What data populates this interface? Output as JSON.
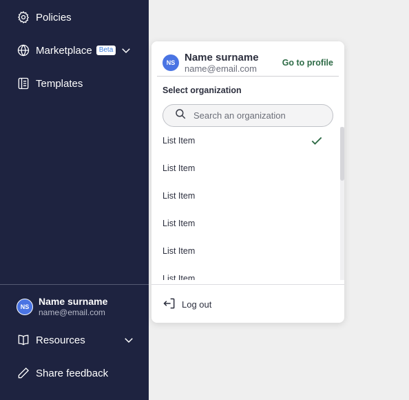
{
  "sidebar": {
    "nav": [
      {
        "label": "Policies",
        "icon": "gear-icon"
      },
      {
        "label": "Marketplace",
        "icon": "globe-icon",
        "badge": "Beta"
      },
      {
        "label": "Templates",
        "icon": "template-icon"
      }
    ],
    "user": {
      "initials": "NS",
      "name": "Name surname",
      "email": "name@email.com"
    },
    "resources_label": "Resources",
    "feedback_label": "Share feedback"
  },
  "popup": {
    "user": {
      "initials": "NS",
      "name": "Name surname",
      "email": "name@email.com"
    },
    "go_to_profile": "Go to profile",
    "select_label": "Select organization",
    "search_placeholder": "Search an organization",
    "items": [
      {
        "label": "List Item",
        "selected": true
      },
      {
        "label": "List Item",
        "selected": false
      },
      {
        "label": "List Item",
        "selected": false
      },
      {
        "label": "List Item",
        "selected": false
      },
      {
        "label": "List Item",
        "selected": false
      },
      {
        "label": "List Item",
        "selected": false
      }
    ],
    "logout_label": "Log out"
  },
  "colors": {
    "sidebar_bg": "#1e2340",
    "avatar": "#4a74e3",
    "accent_green": "#2e6b46",
    "badge_text": "#3b7ddd"
  }
}
